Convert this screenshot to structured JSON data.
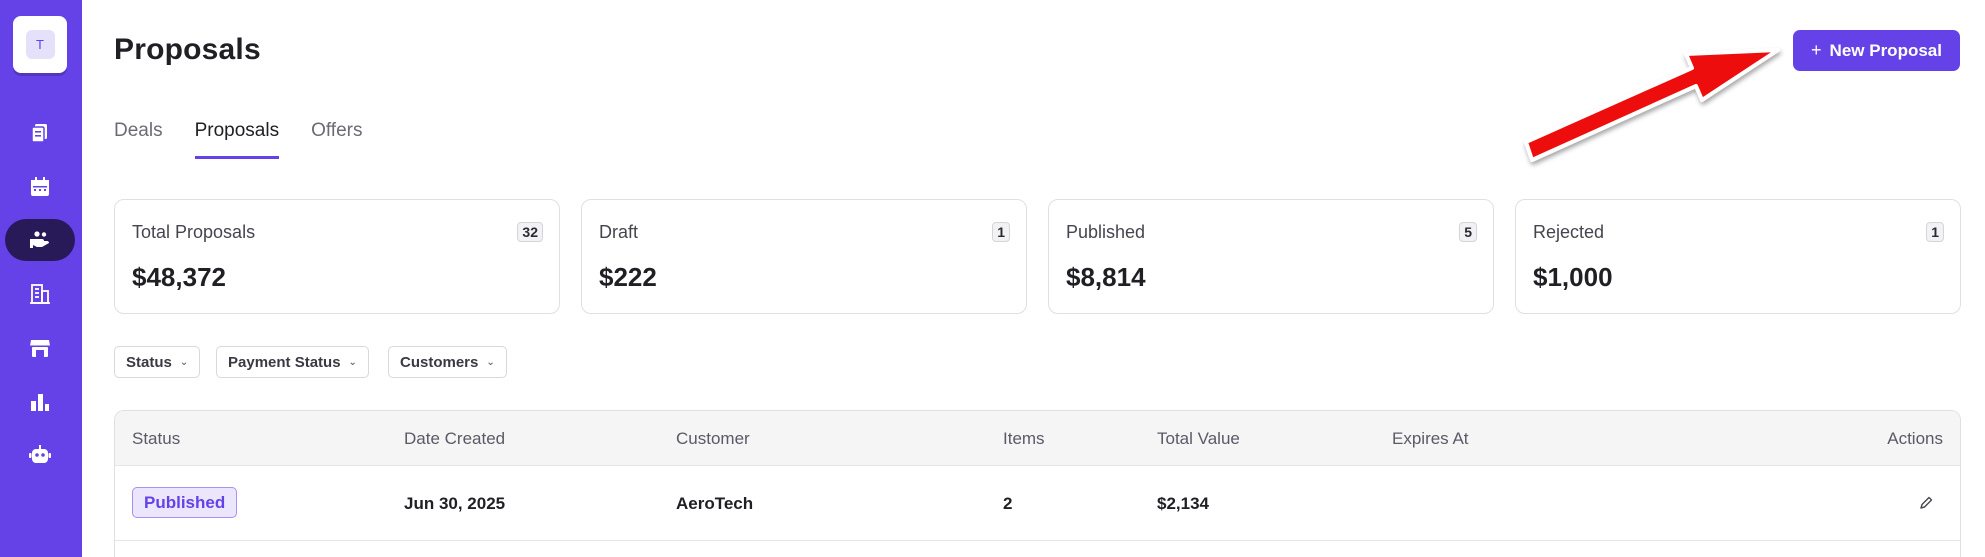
{
  "sidebar": {
    "workspace_initial": "T",
    "items": [
      {
        "icon": "documents-icon"
      },
      {
        "icon": "calendar-icon"
      },
      {
        "icon": "hand-deal-icon",
        "active": true
      },
      {
        "icon": "building-icon"
      },
      {
        "icon": "store-icon"
      },
      {
        "icon": "bar-chart-icon"
      },
      {
        "icon": "robot-icon"
      }
    ]
  },
  "header": {
    "title": "Proposals",
    "new_button_label": "New Proposal",
    "new_button_icon": "+"
  },
  "tabs": [
    {
      "label": "Deals",
      "active": false
    },
    {
      "label": "Proposals",
      "active": true
    },
    {
      "label": "Offers",
      "active": false
    }
  ],
  "stats": [
    {
      "label": "Total Proposals",
      "count": "32",
      "value": "$48,372"
    },
    {
      "label": "Draft",
      "count": "1",
      "value": "$222"
    },
    {
      "label": "Published",
      "count": "5",
      "value": "$8,814"
    },
    {
      "label": "Rejected",
      "count": "1",
      "value": "$1,000"
    }
  ],
  "filters": [
    {
      "label": "Status"
    },
    {
      "label": "Payment Status"
    },
    {
      "label": "Customers"
    }
  ],
  "table": {
    "columns": [
      "Status",
      "Date Created",
      "Customer",
      "Items",
      "Total Value",
      "Expires At",
      "Actions"
    ],
    "rows": [
      {
        "status": "Published",
        "date_created": "Jun 30, 2025",
        "customer": "AeroTech",
        "items": "2",
        "total_value": "$2,134",
        "expires_at": ""
      }
    ]
  },
  "colors": {
    "accent": "#6442e8",
    "sidebar_active": "#281a59",
    "annotation_arrow": "#ee1111"
  }
}
